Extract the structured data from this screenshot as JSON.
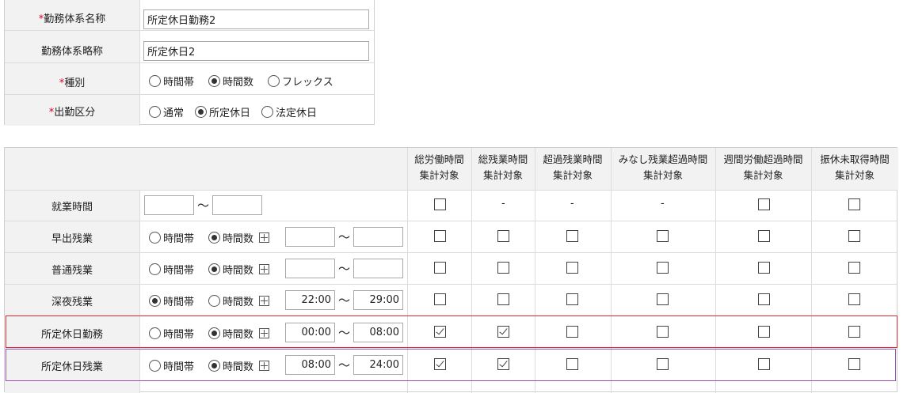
{
  "form": {
    "rows": [
      {
        "label": "勤務体系名称",
        "required": true
      },
      {
        "label": "勤務体系略称",
        "required": false
      },
      {
        "label": "種別",
        "required": true
      },
      {
        "label": "出勤区分",
        "required": true
      }
    ],
    "required_mark": "*",
    "name_value": "所定休日勤務2",
    "abbr_value": "所定休日2",
    "type_options": [
      "時間帯",
      "時間数",
      "フレックス"
    ],
    "type_selected": "時間数",
    "attend_options": [
      "通常",
      "所定休日",
      "法定休日"
    ],
    "attend_selected": "所定休日"
  },
  "table": {
    "headers": [
      [
        "総労働時間",
        "集計対象"
      ],
      [
        "総残業時間",
        "集計対象"
      ],
      [
        "超過残業時間",
        "集計対象"
      ],
      [
        "みなし残業超過時間",
        "集計対象"
      ],
      [
        "週間労働超過時間",
        "集計対象"
      ],
      [
        "振休未取得時間",
        "集計対象"
      ]
    ],
    "tilde": "〜",
    "dash": "-",
    "mode_options": [
      "時間帯",
      "時間数"
    ],
    "rows": [
      {
        "label": "就業時間",
        "kind": "range_only",
        "from": "",
        "to": "",
        "checks": [
          false,
          null,
          null,
          null,
          false,
          false
        ]
      },
      {
        "label": "早出残業",
        "kind": "mode",
        "mode": "時間数",
        "from": "",
        "to": "",
        "checks": [
          false,
          false,
          false,
          false,
          false,
          false
        ]
      },
      {
        "label": "普通残業",
        "kind": "mode",
        "mode": "時間数",
        "from": "",
        "to": "",
        "checks": [
          false,
          false,
          false,
          false,
          false,
          false
        ]
      },
      {
        "label": "深夜残業",
        "kind": "mode",
        "mode": "時間帯",
        "from": "22:00",
        "to": "29:00",
        "checks": [
          false,
          false,
          false,
          false,
          false,
          false
        ]
      },
      {
        "label": "所定休日勤務",
        "kind": "mode",
        "mode": "時間数",
        "from": "00:00",
        "to": "08:00",
        "checks": [
          true,
          true,
          false,
          false,
          false,
          false
        ]
      },
      {
        "label": "所定休日残業",
        "kind": "mode",
        "mode": "時間数",
        "from": "08:00",
        "to": "24:00",
        "checks": [
          true,
          true,
          false,
          false,
          false,
          false
        ]
      }
    ]
  },
  "colors": {
    "highlight_red": "#e0262e",
    "highlight_purple": "#9b4fb3"
  }
}
